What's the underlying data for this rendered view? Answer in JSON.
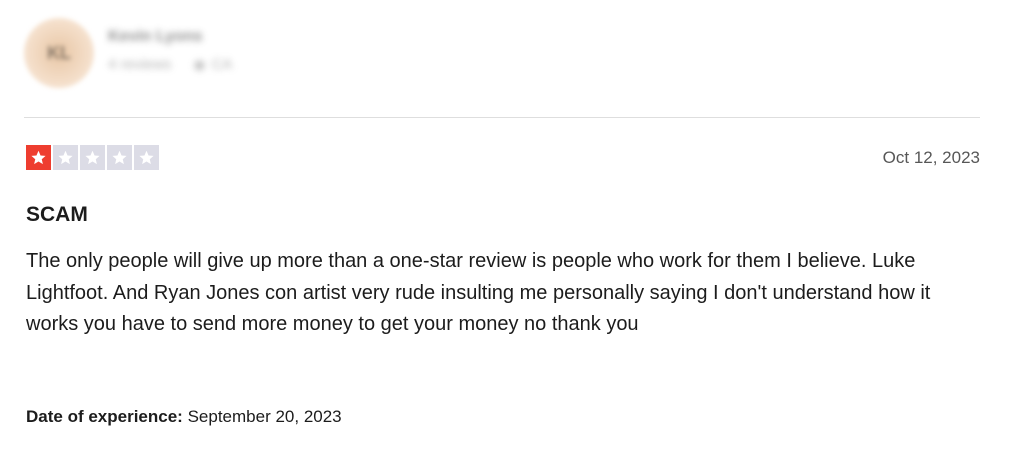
{
  "reviewer": {
    "name": "Kevin Lyons",
    "reviews": "4 reviews",
    "country": "CA",
    "avatar_initials": "KL"
  },
  "review": {
    "rating": 1,
    "max_rating": 5,
    "date": "Oct 12, 2023",
    "title": "SCAM",
    "body": "The only people will give up more than a one-star review is people who work for them I believe. Luke Lightfoot. And Ryan Jones con artist very rude insulting me personally saying I don't understand how it works you have to send more money to get your money no thank you",
    "experience_label": "Date of experience:",
    "experience_date": "September 20, 2023"
  },
  "colors": {
    "star_filled": "#ee3d2f",
    "star_empty": "#dcdce6",
    "text": "#1c1c1c",
    "muted": "#575757",
    "divider": "#dedede"
  },
  "icons": {
    "star": "star-icon",
    "location": "location-pin-icon"
  }
}
